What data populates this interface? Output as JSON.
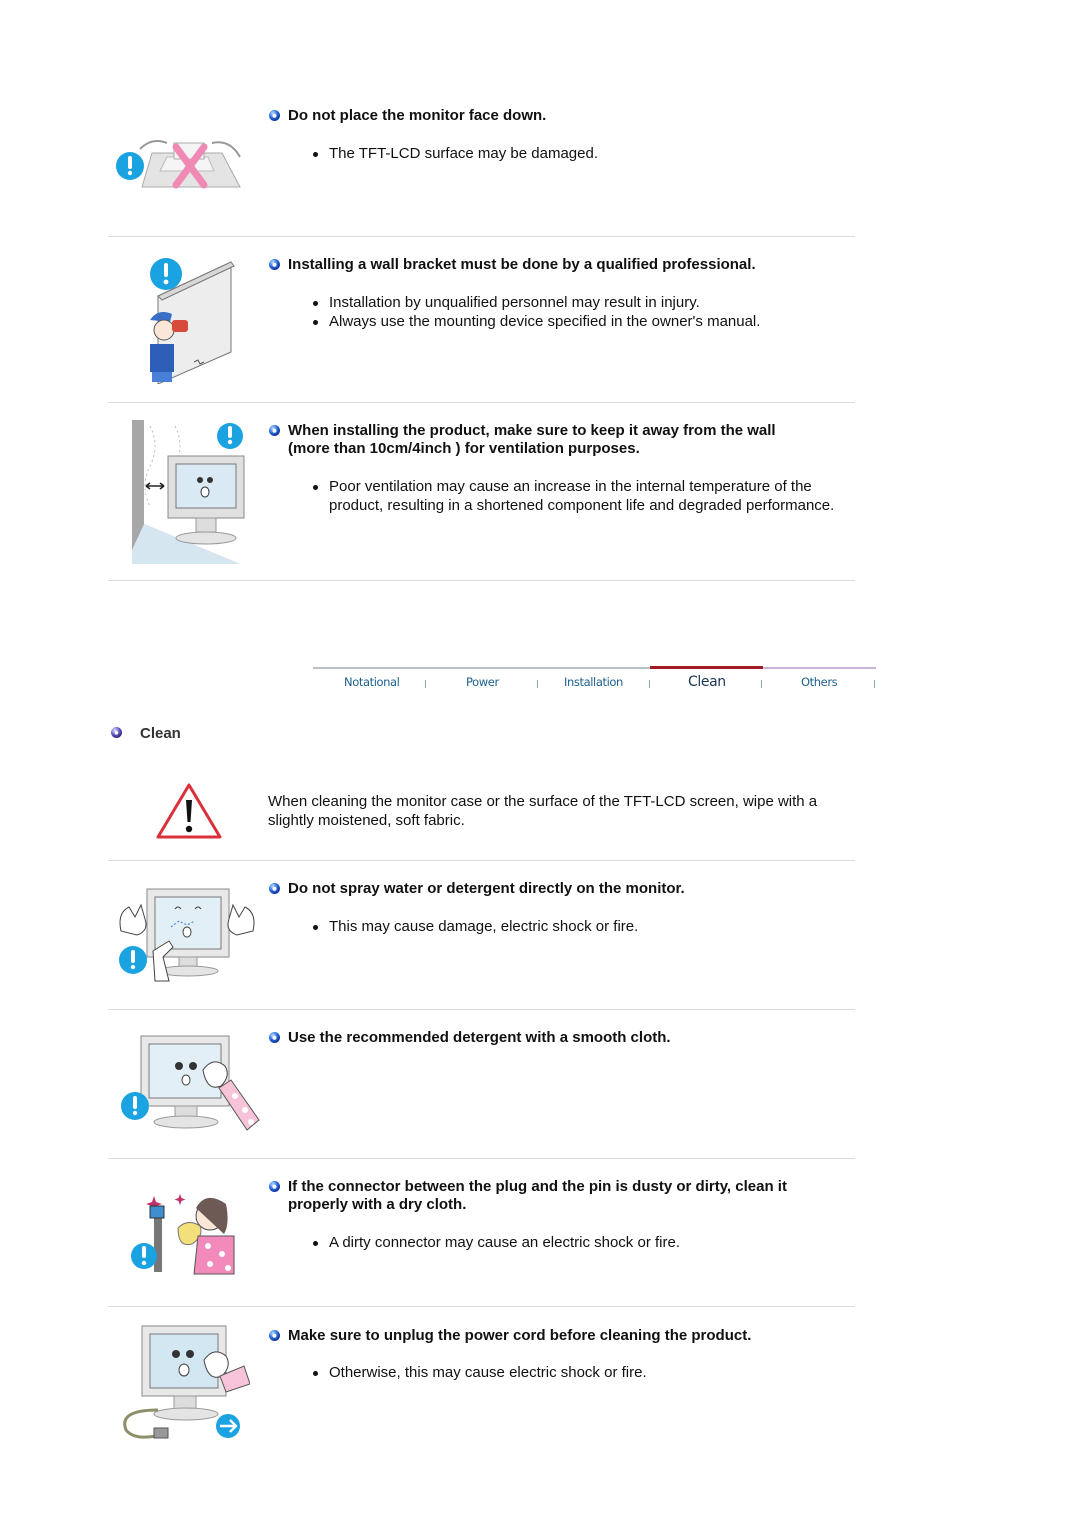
{
  "top_items": [
    {
      "heading": "Do not place the monitor face down.",
      "bullets": [
        "The TFT-LCD surface may be damaged."
      ],
      "illustration": "monitor-face-down-illustration"
    },
    {
      "heading": "Installing a wall bracket must be done by a qualified professional.",
      "bullets": [
        "Installation by unqualified personnel may result in injury.",
        "Always use the mounting device specified in the owner's manual."
      ],
      "illustration": "wall-bracket-installer-illustration"
    },
    {
      "heading_line1": "When installing the product, make sure to keep it away from the wall",
      "heading_line2": "(more than 10cm/4inch ) for ventilation purposes.",
      "bullets": [
        "Poor ventilation may cause an increase in the internal temperature of the product, resulting in a shortened component life and degraded performance."
      ],
      "illustration": "wall-ventilation-gap-illustration"
    }
  ],
  "tabs": [
    {
      "label": "Notational",
      "active": false
    },
    {
      "label": "Power",
      "active": false
    },
    {
      "label": "Installation",
      "active": false
    },
    {
      "label": "Clean",
      "active": true
    },
    {
      "label": "Others",
      "active": false
    }
  ],
  "colors": {
    "tab_line": "#b8c3c6",
    "tab_active_line": "#a01c22",
    "tab_after_line": "#c8b5d8",
    "bullet_blue": "#2a5fd0",
    "section_bullet": "#6a5fc8",
    "warning_red": "#d9303a",
    "exclaim_blue": "#1aa3e0"
  },
  "section": {
    "title": "Clean",
    "intro": "When cleaning the monitor case or the surface of the TFT-LCD screen, wipe with a slightly moistened, soft fabric."
  },
  "clean_items": [
    {
      "heading": "Do not spray water or detergent directly on the monitor.",
      "bullets": [
        "This may cause damage, electric shock or fire."
      ]
    },
    {
      "heading": "Use the recommended detergent with a smooth cloth.",
      "bullets": []
    },
    {
      "heading_line1": "If the connector between the plug and the pin is dusty or dirty, clean it",
      "heading_line2": "properly with a dry cloth.",
      "bullets": [
        "A dirty connector may cause an electric shock or fire."
      ]
    },
    {
      "heading": "Make sure to unplug the power cord before cleaning the product.",
      "bullets": [
        "Otherwise, this may cause electric shock or fire."
      ]
    }
  ]
}
